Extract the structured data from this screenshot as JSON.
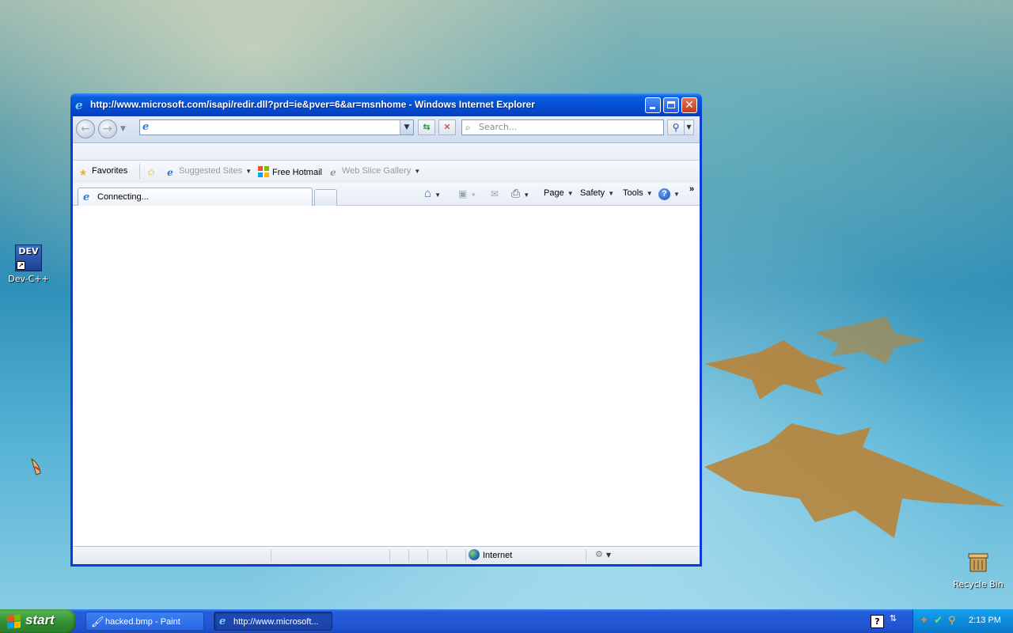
{
  "desktop": {
    "icons": [
      {
        "label": "Dev-C++",
        "badge": "DEV"
      },
      {
        "label": "Recycle Bin"
      }
    ]
  },
  "window": {
    "title": "http://www.microsoft.com/isapi/redir.dll?prd=ie&pver=6&ar=msnhome - Windows Internet Explorer",
    "address_value": "",
    "search_placeholder": "Search...",
    "favorites_bar": {
      "favorites_label": "Favorites",
      "suggested_sites_label": "Suggested Sites",
      "free_hotmail_label": "Free Hotmail",
      "web_slice_gallery_label": "Web Slice Gallery"
    },
    "tab": {
      "label": "Connecting..."
    },
    "command_bar": {
      "page_label": "Page",
      "safety_label": "Safety",
      "tools_label": "Tools",
      "overflow": "»"
    },
    "status_bar": {
      "zone": "Internet"
    }
  },
  "taskbar": {
    "start_label": "start",
    "tasks": [
      {
        "label": "hacked.bmp - Paint"
      },
      {
        "label": "http://www.microsoft..."
      }
    ],
    "clock": "2:13 PM"
  }
}
